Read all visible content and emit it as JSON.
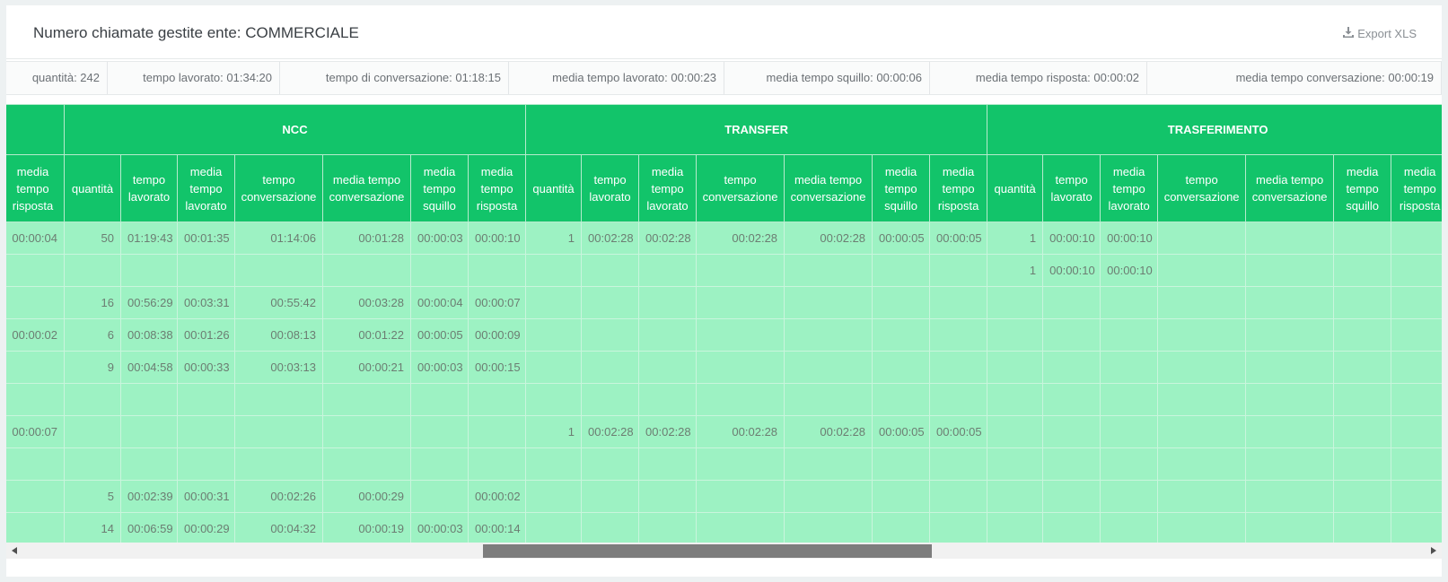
{
  "header": {
    "title": "Numero chiamate gestite ente: COMMERCIALE",
    "export_label": "Export XLS",
    "export_icon": "download-icon"
  },
  "summary": [
    "quantità: 242",
    "tempo lavorato: 01:34:20",
    "tempo di conversazione: 01:18:15",
    "media tempo lavorato: 00:00:23",
    "media tempo squillo: 00:00:06",
    "media tempo risposta: 00:00:02",
    "media tempo conversazione: 00:00:19"
  ],
  "table": {
    "groups": [
      "",
      "NCC",
      "TRANSFER",
      "TRASFERIMENTO"
    ],
    "columns": [
      "media tempo risposta",
      "quantità",
      "tempo lavorato",
      "media tempo lavorato",
      "tempo conversazione",
      "media tempo conversazione",
      "media tempo squillo",
      "media tempo risposta",
      "quantità",
      "tempo lavorato",
      "media tempo lavorato",
      "tempo conversazione",
      "media tempo conversazione",
      "media tempo squillo",
      "media tempo risposta",
      "quantità",
      "tempo lavorato",
      "media tempo lavorato",
      "tempo conversazione",
      "media tempo conversazione",
      "media tempo squillo",
      "media tempo risposta"
    ],
    "rows": [
      [
        "00:00:04",
        "50",
        "01:19:43",
        "00:01:35",
        "01:14:06",
        "00:01:28",
        "00:00:03",
        "00:00:10",
        "1",
        "00:02:28",
        "00:02:28",
        "00:02:28",
        "00:02:28",
        "00:00:05",
        "00:00:05",
        "1",
        "00:00:10",
        "00:00:10",
        "",
        "",
        "",
        ""
      ],
      [
        "",
        "",
        "",
        "",
        "",
        "",
        "",
        "",
        "",
        "",
        "",
        "",
        "",
        "",
        "",
        "1",
        "00:00:10",
        "00:00:10",
        "",
        "",
        "",
        ""
      ],
      [
        "",
        "16",
        "00:56:29",
        "00:03:31",
        "00:55:42",
        "00:03:28",
        "00:00:04",
        "00:00:07",
        "",
        "",
        "",
        "",
        "",
        "",
        "",
        "",
        "",
        "",
        "",
        "",
        "",
        ""
      ],
      [
        "00:00:02",
        "6",
        "00:08:38",
        "00:01:26",
        "00:08:13",
        "00:01:22",
        "00:00:05",
        "00:00:09",
        "",
        "",
        "",
        "",
        "",
        "",
        "",
        "",
        "",
        "",
        "",
        "",
        "",
        ""
      ],
      [
        "",
        "9",
        "00:04:58",
        "00:00:33",
        "00:03:13",
        "00:00:21",
        "00:00:03",
        "00:00:15",
        "",
        "",
        "",
        "",
        "",
        "",
        "",
        "",
        "",
        "",
        "",
        "",
        "",
        ""
      ],
      [
        "",
        "",
        "",
        "",
        "",
        "",
        "",
        "",
        "",
        "",
        "",
        "",
        "",
        "",
        "",
        "",
        "",
        "",
        "",
        "",
        "",
        ""
      ],
      [
        "00:00:07",
        "",
        "",
        "",
        "",
        "",
        "",
        "",
        "1",
        "00:02:28",
        "00:02:28",
        "00:02:28",
        "00:02:28",
        "00:00:05",
        "00:00:05",
        "",
        "",
        "",
        "",
        "",
        "",
        ""
      ],
      [
        "",
        "",
        "",
        "",
        "",
        "",
        "",
        "",
        "",
        "",
        "",
        "",
        "",
        "",
        "",
        "",
        "",
        "",
        "",
        "",
        "",
        ""
      ],
      [
        "",
        "5",
        "00:02:39",
        "00:00:31",
        "00:02:26",
        "00:00:29",
        "",
        "00:00:02",
        "",
        "",
        "",
        "",
        "",
        "",
        "",
        "",
        "",
        "",
        "",
        "",
        "",
        ""
      ],
      [
        "",
        "14",
        "00:06:59",
        "00:00:29",
        "00:04:32",
        "00:00:19",
        "00:00:03",
        "00:00:14",
        "",
        "",
        "",
        "",
        "",
        "",
        "",
        "",
        "",
        "",
        "",
        "",
        "",
        ""
      ]
    ]
  },
  "colors": {
    "header_green": "#12c46a",
    "row_green": "#9df2c3"
  }
}
